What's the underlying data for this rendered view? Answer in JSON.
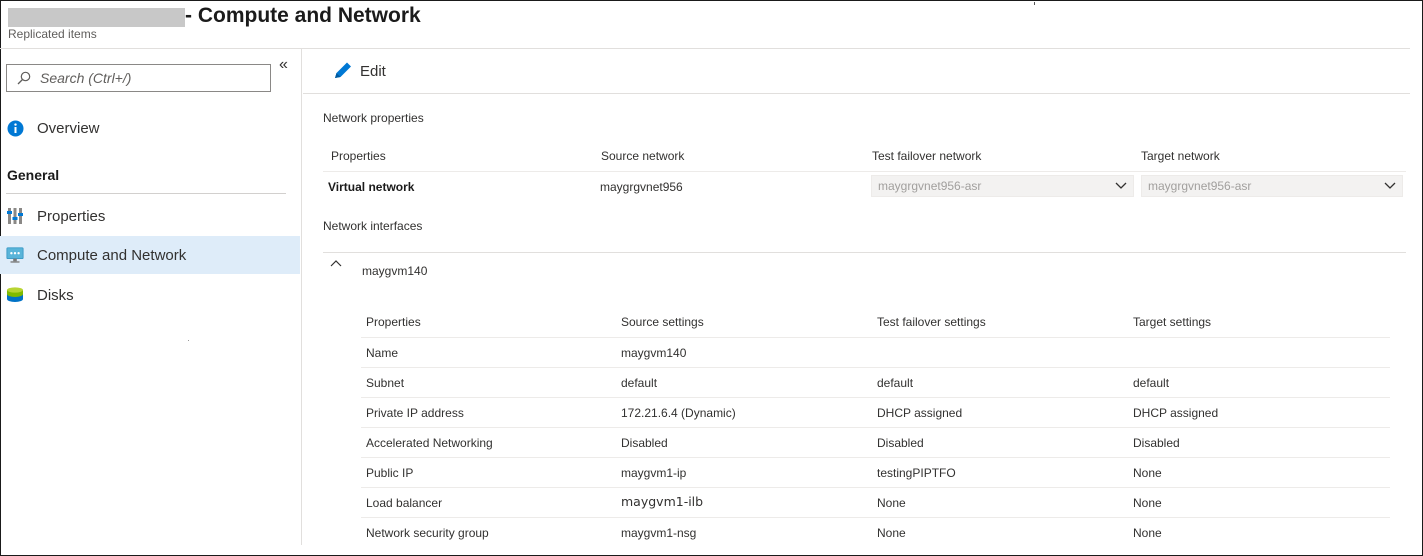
{
  "header": {
    "title": "- Compute and Network",
    "subtitle": "Replicated items"
  },
  "sidebar": {
    "search_placeholder": "Search (Ctrl+/)",
    "collapse_glyph": "«",
    "overview_label": "Overview",
    "group_label": "General",
    "items": [
      {
        "label": "Properties"
      },
      {
        "label": "Compute and Network",
        "active": true
      },
      {
        "label": "Disks"
      }
    ]
  },
  "toolbar": {
    "edit_label": "Edit"
  },
  "network_properties": {
    "section_label": "Network properties",
    "headers": [
      "Properties",
      "Source network",
      "Test failover network",
      "Target network"
    ],
    "row": {
      "property": "Virtual network",
      "source": "maygrgvnet956",
      "test_failover": "maygrgvnet956-asr",
      "target": "maygrgvnet956-asr"
    }
  },
  "network_interfaces": {
    "section_label": "Network interfaces",
    "nic_name": "maygvm140",
    "headers": [
      "Properties",
      "Source settings",
      "Test failover settings",
      "Target settings"
    ],
    "rows": [
      {
        "property": "Name",
        "source": "maygvm140",
        "test_failover": "",
        "target": ""
      },
      {
        "property": "Subnet",
        "source": "default",
        "test_failover": "default",
        "target": "default"
      },
      {
        "property": "Private IP address",
        "source": "172.21.6.4 (Dynamic)",
        "test_failover": "DHCP assigned",
        "target": "DHCP assigned"
      },
      {
        "property": "Accelerated Networking",
        "source": "Disabled",
        "test_failover": "Disabled",
        "target": "Disabled"
      },
      {
        "property": "Public IP",
        "source": "maygvm1-ip",
        "test_failover": "testingPIPTFO",
        "target": "None"
      },
      {
        "property": "Load balancer",
        "source": "maygvm1-ilb",
        "test_failover": "None",
        "target": "None"
      },
      {
        "property": "Network security group",
        "source": "maygvm1-nsg",
        "test_failover": "None",
        "target": "None"
      }
    ]
  },
  "colors": {
    "accent": "#0078d4",
    "active_nav_bg": "#deecf9",
    "redaction": "#c8c8c8"
  }
}
